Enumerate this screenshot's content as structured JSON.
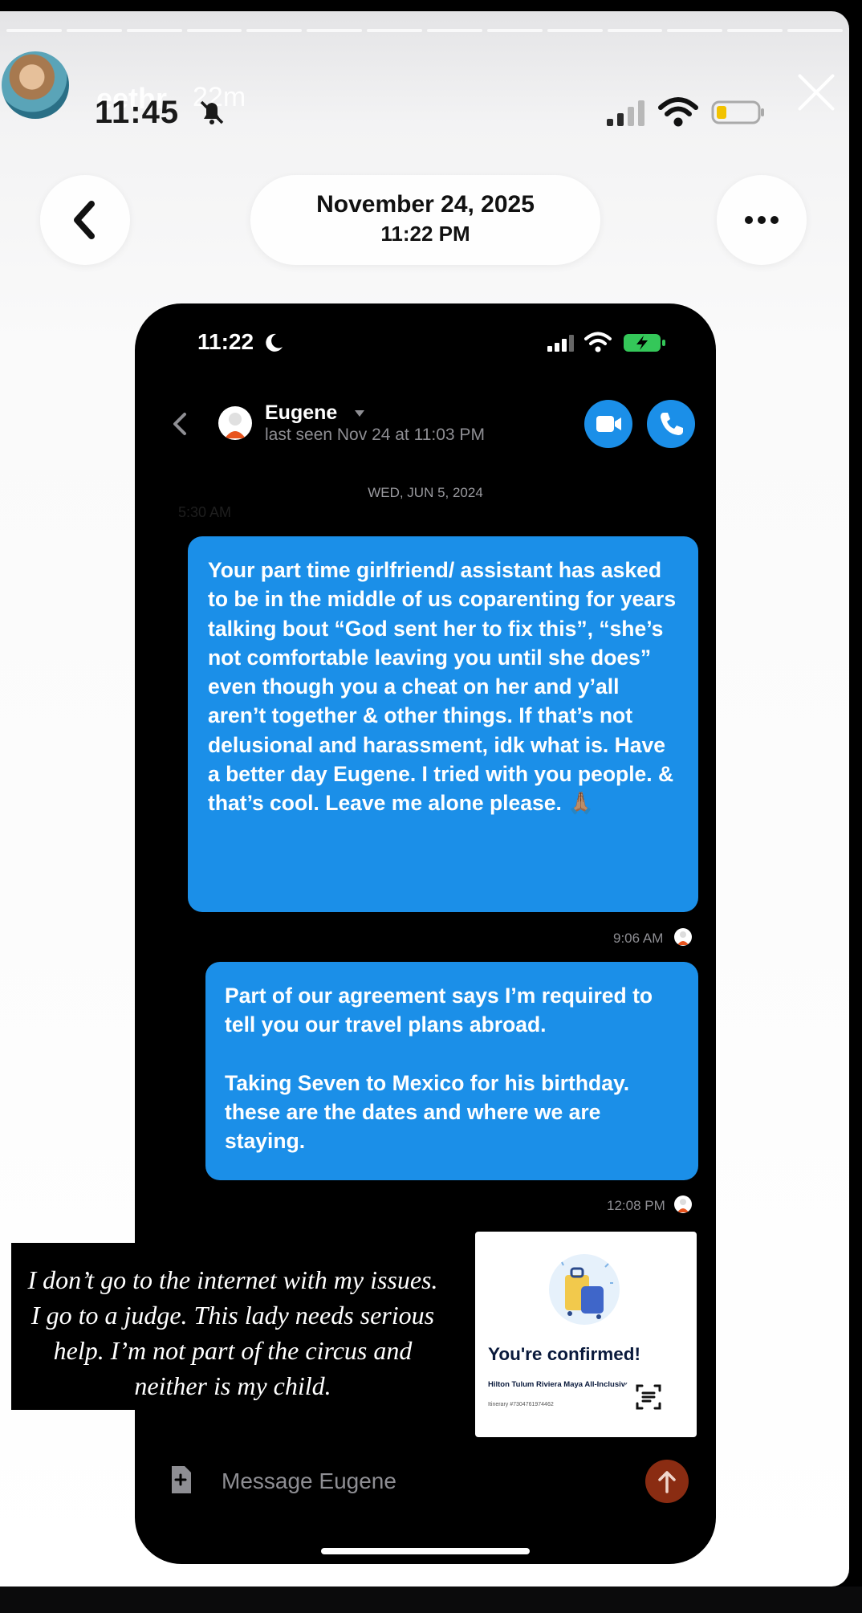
{
  "story": {
    "username": "eethr",
    "age": "22m",
    "status_time": "11:45"
  },
  "header": {
    "date": "November 24, 2025",
    "time": "11:22 PM"
  },
  "phone": {
    "status_time": "11:22",
    "contact_name": "Eugene",
    "last_seen": "last seen Nov 24 at 11:03 PM",
    "date_separator": "WED, JUN 5, 2024",
    "faint_time": "5:30 AM",
    "messages": [
      {
        "text": "Your part time girlfriend/ assistant has asked to be in the middle of us coparenting for years talking bout “God sent her to fix this”, “she’s not comfortable leaving you until she does” even though you a cheat on her and y’all aren’t together & other things. If that’s not delusional and harassment, idk what is. Have a better day Eugene. I tried with you people. & that’s cool. Leave me alone please. ",
        "emoji": "🙏🏽",
        "time": "9:06 AM"
      },
      {
        "text": "Part of our agreement says I’m required to tell you our travel plans abroad.\n\nTaking Seven to Mexico for his birthday. these are the dates and where we are staying.",
        "time": "12:08 PM"
      }
    ],
    "confirmation": {
      "title": "You're confirmed!",
      "hotel": "Hilton Tulum Riviera Maya All-Inclusive Resort",
      "sub": "Itinerary #7304761974462"
    },
    "compose_placeholder": "Message Eugene"
  },
  "overlay_text": "I don’t go to the internet with my issues. I go to a judge. This lady needs serious help. I’m not part of the circus and neither is my child.",
  "icons": [
    "close-icon",
    "back-chevron-icon",
    "more-icon",
    "bell-slash-icon",
    "signal-icon",
    "wifi-icon",
    "battery-icon",
    "moon-icon",
    "video-call-icon",
    "phone-call-icon",
    "scan-text-icon",
    "attachment-icon",
    "send-arrow-icon"
  ],
  "colors": {
    "bubble": "#1b8fe8",
    "send_button": "#8a2c12",
    "call_button": "#1b8fe8"
  }
}
